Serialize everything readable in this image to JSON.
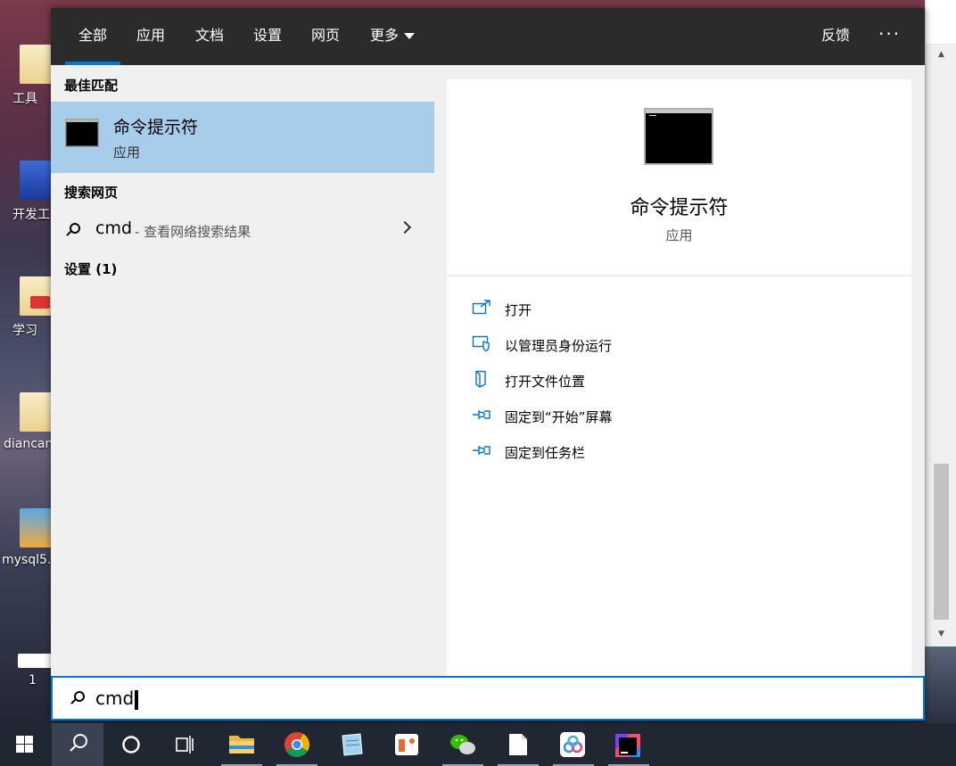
{
  "tabs": [
    {
      "label": "全部",
      "active": true
    },
    {
      "label": "应用"
    },
    {
      "label": "文档"
    },
    {
      "label": "设置"
    },
    {
      "label": "网页"
    },
    {
      "label": "更多"
    }
  ],
  "header": {
    "feedback": "反馈",
    "more_options": "···"
  },
  "left": {
    "best_match_heading": "最佳匹配",
    "best_match": {
      "title": "命令提示符",
      "subtitle": "应用"
    },
    "web_heading": "搜索网页",
    "web_result": {
      "query": "cmd",
      "desc": "- 查看网络搜索结果"
    },
    "settings_heading": "设置 (1)"
  },
  "right": {
    "title": "命令提示符",
    "subtitle": "应用",
    "actions": [
      {
        "label": "打开",
        "icon": "open-icon"
      },
      {
        "label": "以管理员身份运行",
        "icon": "admin-shield-icon"
      },
      {
        "label": "打开文件位置",
        "icon": "file-location-icon"
      },
      {
        "label": "固定到“开始”屏幕",
        "icon": "pin-icon"
      },
      {
        "label": "固定到任务栏",
        "icon": "pin-icon"
      }
    ]
  },
  "search": {
    "value": "cmd"
  },
  "desktop_icons": [
    {
      "label": "工具"
    },
    {
      "label": "开发工"
    },
    {
      "label": "学习"
    },
    {
      "label": "diancan"
    },
    {
      "label": "mysql5."
    },
    {
      "label": "1"
    }
  ],
  "taskbar": [
    "windows-start-icon",
    "search-icon",
    "cortana-icon",
    "task-view-icon",
    "file-explorer-icon",
    "chrome-icon",
    "notepad-icon",
    "screenshot-app-icon",
    "wechat-icon",
    "document-icon",
    "baidu-netdisk-icon",
    "intellij-icon"
  ],
  "colors": {
    "accent": "#0078d7",
    "selected": "#a8cdeb",
    "tabbar": "#2b2b2b",
    "taskbar": "#202733"
  }
}
